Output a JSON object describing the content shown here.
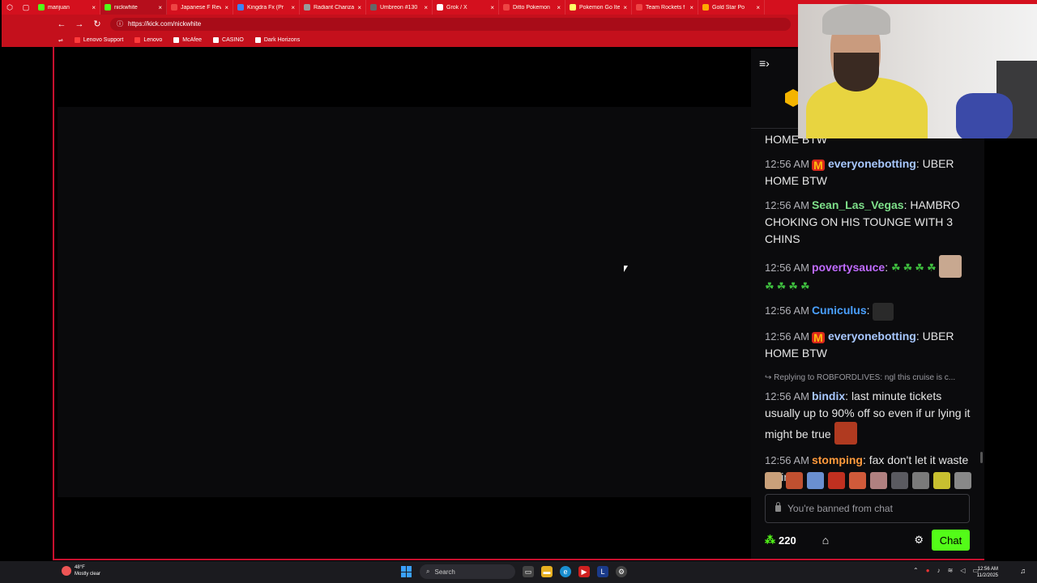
{
  "browser": {
    "tabs": [
      {
        "title": "marijuan",
        "color": "#53fc18"
      },
      {
        "title": "nickwhite",
        "color": "#53fc18",
        "active": true
      },
      {
        "title": "Japanese F Rev",
        "color": "#e44"
      },
      {
        "title": "Kingdra Fx (Pr",
        "color": "#3b82f6"
      },
      {
        "title": "Radiant Charizar",
        "color": "#999"
      },
      {
        "title": "Umbreon #130",
        "color": "#666"
      },
      {
        "title": "Grok / X",
        "color": "#fff"
      },
      {
        "title": "Ditto Pokemon",
        "color": "#e44"
      },
      {
        "title": "Pokemon Go Ite",
        "color": "#ff6"
      },
      {
        "title": "Team Rockets f",
        "color": "#e44"
      },
      {
        "title": "Gold Star Po",
        "color": "#fa0"
      }
    ],
    "url": "https://kick.com/nickwhite",
    "bookmarks": [
      "Lenovo Support",
      "Lenovo",
      "McAfee",
      "CASINO",
      "Dark Horizons"
    ]
  },
  "chat": {
    "messages": [
      {
        "partial": "HOME BTW"
      },
      {
        "time": "12:56 AM",
        "mcd": true,
        "user": "everyonebotting",
        "color": "#a8c8ff",
        "text": ": UBER HOME BTW"
      },
      {
        "time": "12:56 AM",
        "user": "Sean_Las_Vegas",
        "color": "#7ee08a",
        "text": ": HAMBRO CHOKING ON HIS TOUNGE WITH 3 CHINS"
      },
      {
        "time": "12:56 AM",
        "user": "povertysauce",
        "color": "#c06bff",
        "text": ":",
        "weed": true
      },
      {
        "time": "12:56 AM",
        "user": "Cuniculus",
        "color": "#4aa0ff",
        "text": ":",
        "emote": true
      },
      {
        "time": "12:56 AM",
        "mcd": true,
        "user": "everyonebotting",
        "color": "#a8c8ff",
        "text": ": UBER HOME BTW"
      },
      {
        "reply": "Replying to ROBFORDLIVES: ngl this cruise is c...",
        "time": "12:56 AM",
        "user": "bindix",
        "color": "#a8c8ff",
        "text": ": last minute tickets usually up to 90% off so even if ur lying it might be true",
        "face": true
      },
      {
        "time": "12:56 AM",
        "user": "stomping",
        "color": "#ff9a3c",
        "text": ": fax don't let it waste ur time"
      }
    ],
    "banned_placeholder": "You're banned from chat",
    "points": "220",
    "chat_button": "Chat",
    "emote_colors": [
      "#c9a07a",
      "#c05030",
      "#6a8fd0",
      "#c03020",
      "#d05a3a",
      "#b08080",
      "#5a5a60",
      "#7a7a7a",
      "#c8c030",
      "#888888"
    ]
  },
  "taskbar": {
    "weather_temp": "48°F",
    "weather_desc": "Mostly clear",
    "search_label": "Search",
    "time": "12:56 AM",
    "date": "11/2/2025"
  }
}
